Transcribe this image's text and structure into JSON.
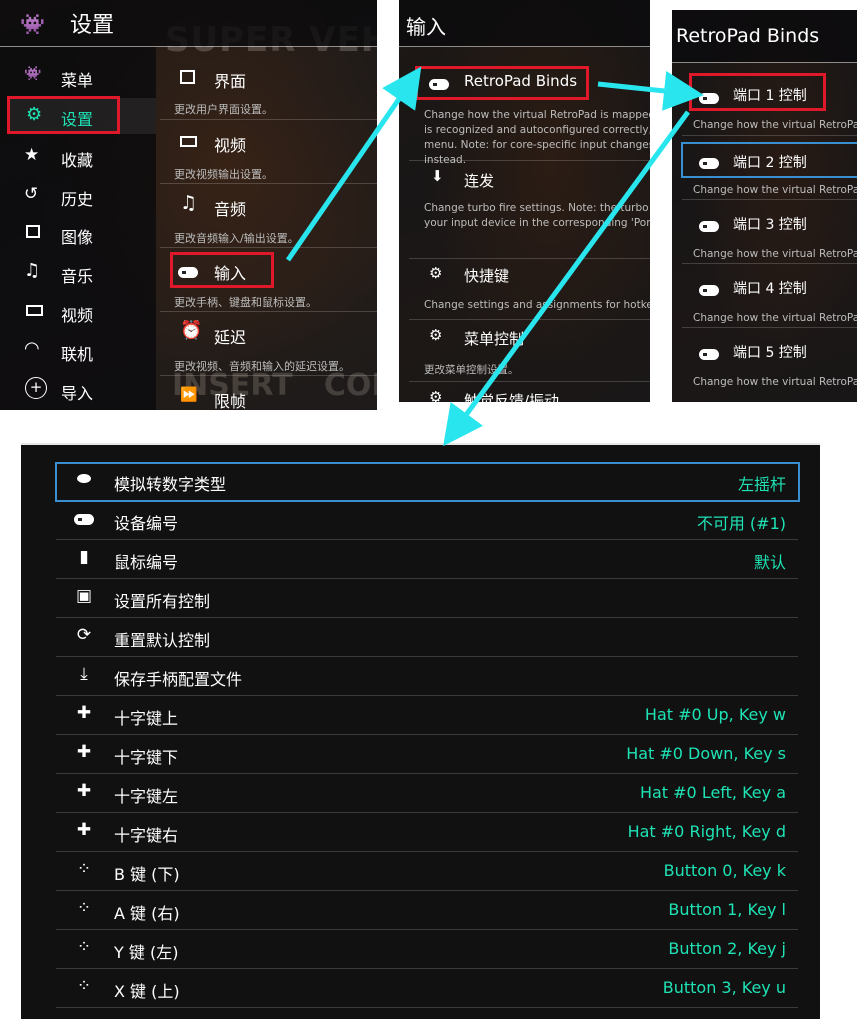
{
  "panel1": {
    "title": "设置",
    "bg_text_top": "SUPER VEHIC",
    "bg_text_bottom": "INSERT   COIN",
    "sidebar": [
      {
        "label": "菜单",
        "icon": "invader-icon"
      },
      {
        "label": "设置",
        "icon": "gear-icon"
      },
      {
        "label": "收藏",
        "icon": "star-icon"
      },
      {
        "label": "历史",
        "icon": "history-icon"
      },
      {
        "label": "图像",
        "icon": "image-icon"
      },
      {
        "label": "音乐",
        "icon": "music-icon"
      },
      {
        "label": "视频",
        "icon": "film-icon"
      },
      {
        "label": "联机",
        "icon": "netplay-icon"
      },
      {
        "label": "导入",
        "icon": "add-icon"
      }
    ],
    "items": [
      {
        "label": "界面",
        "sub": "更改用户界面设置。"
      },
      {
        "label": "视频",
        "sub": "更改视频输出设置。"
      },
      {
        "label": "音频",
        "sub": "更改音频输入/输出设置。"
      },
      {
        "label": "输入",
        "sub": "更改手柄、键盘和鼠标设置。"
      },
      {
        "label": "延迟",
        "sub": "更改视频、音频和输入的延迟设置。"
      },
      {
        "label": "限帧",
        "sub": ""
      }
    ]
  },
  "panel2": {
    "title": "输入",
    "items": [
      {
        "label": "RetroPad Binds",
        "sub": "Change how the virtual RetroPad is mapped to a physical input device. If an input device is recognized and autoconfigured correctly, users probably do not need to use this menu. Note: for core-specific input changes, use the Quick Menu's 'Controls' submenu instead."
      },
      {
        "label": "连发",
        "sub": "Change turbo fire settings. Note: the turbo function requires mapping a turbo button to your input device in the corresponding 'Port X Controls' menu."
      },
      {
        "label": "快捷键",
        "sub": "Change settings and assignments for hotkeys"
      },
      {
        "label": "菜单控制",
        "sub": "更改菜单控制设置。"
      },
      {
        "label": "触觉反馈/振动",
        "sub": ""
      }
    ]
  },
  "panel3": {
    "title": "RetroPad Binds",
    "items": [
      {
        "label": "端口 1 控制",
        "sub": "Change how the virtual RetroPad"
      },
      {
        "label": "端口 2 控制",
        "sub": "Change how the virtual RetroPad"
      },
      {
        "label": "端口 3 控制",
        "sub": "Change how the virtual RetroPad"
      },
      {
        "label": "端口 4 控制",
        "sub": "Change how the virtual RetroPad"
      },
      {
        "label": "端口 5 控制",
        "sub": "Change how the virtual RetroPad"
      }
    ]
  },
  "panel4": {
    "rows": [
      {
        "label": "模拟转数字类型",
        "value": "左摇杆",
        "icon": "analog-icon"
      },
      {
        "label": "设备编号",
        "value": "不可用 (#1)",
        "icon": "gamepad-icon"
      },
      {
        "label": "鼠标编号",
        "value": "默认",
        "icon": "mouse-icon"
      },
      {
        "label": "设置所有控制",
        "value": "",
        "icon": "bind-all-icon"
      },
      {
        "label": "重置默认控制",
        "value": "",
        "icon": "reset-icon"
      },
      {
        "label": "保存手柄配置文件",
        "value": "",
        "icon": "download-icon"
      },
      {
        "label": "十字键上",
        "value": "Hat #0 Up, Key w",
        "icon": "dpad-up-icon"
      },
      {
        "label": "十字键下",
        "value": "Hat #0 Down, Key s",
        "icon": "dpad-down-icon"
      },
      {
        "label": "十字键左",
        "value": "Hat #0 Left, Key a",
        "icon": "dpad-left-icon"
      },
      {
        "label": "十字键右",
        "value": "Hat #0 Right, Key d",
        "icon": "dpad-right-icon"
      },
      {
        "label": "B 键 (下)",
        "value": "Button 0, Key k",
        "icon": "face-button-down-icon"
      },
      {
        "label": "A 键 (右)",
        "value": "Button 1, Key l",
        "icon": "face-button-right-icon"
      },
      {
        "label": "Y 键 (左)",
        "value": "Button 2, Key j",
        "icon": "face-button-left-icon"
      },
      {
        "label": "X 键 (上)",
        "value": "Button 3, Key u",
        "icon": "face-button-up-icon"
      }
    ]
  },
  "colors": {
    "accent": "#1ee3b4",
    "highlight": "#e0192a",
    "arrow": "#29e6ee",
    "selected_border": "#3a8fd0"
  }
}
